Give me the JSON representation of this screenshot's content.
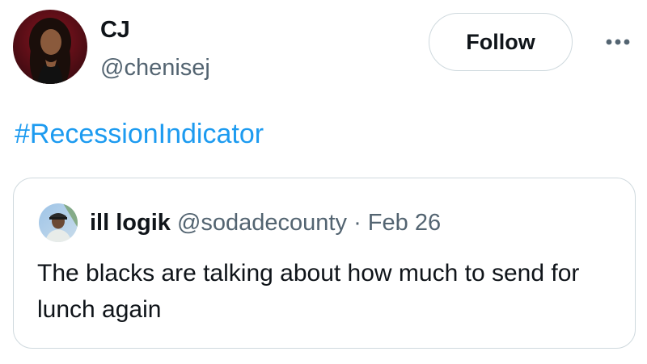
{
  "author": {
    "display_name": "CJ",
    "handle": "@chenisej",
    "avatar_icon": "profile-photo"
  },
  "actions": {
    "follow_label": "Follow",
    "more_icon": "more-horizontal-icon"
  },
  "tweet": {
    "text": "#RecessionIndicator"
  },
  "quoted_tweet": {
    "display_name": "ill logik",
    "handle": "@sodadecounty",
    "separator": "·",
    "date": "Feb 26",
    "text": "The blacks are talking about how much to send for lunch again",
    "avatar_icon": "profile-photo"
  },
  "colors": {
    "link": "#1d9bf0",
    "secondary_text": "#536471",
    "border": "#cfd9de",
    "primary_text": "#0f1419"
  }
}
